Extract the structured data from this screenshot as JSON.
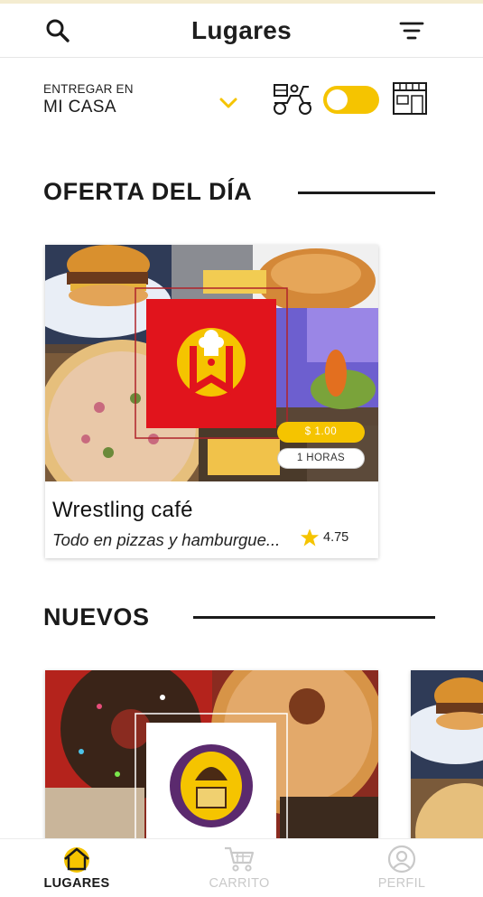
{
  "header": {
    "title": "Lugares",
    "search_icon": "search-icon",
    "filter_icon": "filter-icon"
  },
  "delivery": {
    "label": "ENTREGAR EN",
    "location": "MI CASA",
    "dropdown_icon": "chevron-down-icon",
    "delivery_mode_icon": "delivery-scooter-icon",
    "pickup_mode_icon": "storefront-icon",
    "mode_toggle_on": true
  },
  "offer_section": {
    "title": "OFERTA DEL DÍA",
    "card": {
      "name": "Wrestling café",
      "description": "Todo en pizzas y hamburgue...",
      "rating": "4.75",
      "price": "$ 1.00",
      "time": "1 HORAS",
      "logo_icon": "chef-hat-logo"
    }
  },
  "new_section": {
    "title": "NUEVOS",
    "logo_icon": "cupcake-logo"
  },
  "bottom_nav": {
    "items": [
      {
        "label": "LUGARES",
        "icon": "home-icon",
        "active": true
      },
      {
        "label": "CARRITO",
        "icon": "cart-icon",
        "active": false
      },
      {
        "label": "PERFIL",
        "icon": "user-icon",
        "active": false
      }
    ]
  },
  "colors": {
    "accent": "#f5c400",
    "logo_red": "#e1141c",
    "cupcake_purple": "#5b2a6e",
    "text": "#1a1a1a",
    "inactive": "#c9c9c9"
  }
}
